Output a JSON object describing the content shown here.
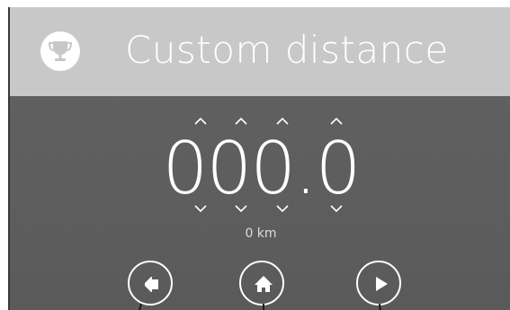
{
  "header": {
    "title": "Custom distance",
    "icon": "trophy-icon"
  },
  "distance": {
    "digits": [
      "0",
      "0",
      "0"
    ],
    "decimal_point": ".",
    "decimal_digit": "0",
    "unit_label": "0 km"
  },
  "controls": {
    "increment_icon": "chevron-up-icon",
    "decrement_icon": "chevron-down-icon"
  },
  "nav": {
    "back_icon": "back-arrow-icon",
    "home_icon": "home-icon",
    "next_icon": "play-icon"
  },
  "colors": {
    "header_bg": "#c8c8c8",
    "screen_bg": "#5f5f5f",
    "foreground": "#ffffff"
  }
}
